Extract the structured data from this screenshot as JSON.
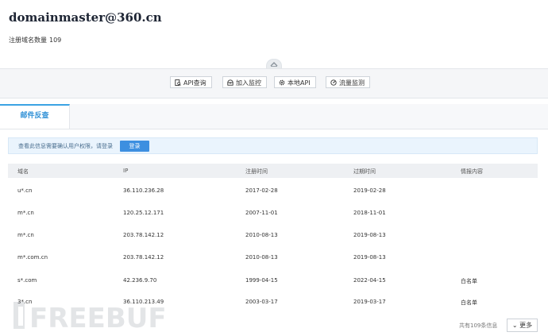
{
  "header": {
    "email": "domainmaster@360.cn",
    "count_label": "注册域名数量",
    "count_value": "109"
  },
  "toolbar": {
    "api_query": "API查询",
    "add_monitor": "加入监控",
    "local_api": "本地API",
    "traffic_monitor": "流量监测"
  },
  "tabs": [
    {
      "label": "邮件反查",
      "active": true
    }
  ],
  "notice": {
    "message": "查看此信息需要确认用户权限，请登录",
    "login_label": "登录"
  },
  "table": {
    "columns": [
      "域名",
      "IP",
      "注册时间",
      "过期时间",
      "情报内容"
    ],
    "rows": [
      {
        "domain": "u*.cn",
        "ip": "36.110.236.28",
        "registered": "2017-02-28",
        "expires": "2019-02-28",
        "intel": ""
      },
      {
        "domain": "m*.cn",
        "ip": "120.25.12.171",
        "registered": "2007-11-01",
        "expires": "2018-11-01",
        "intel": ""
      },
      {
        "domain": "m*.cn",
        "ip": "203.78.142.12",
        "registered": "2010-08-13",
        "expires": "2019-08-13",
        "intel": ""
      },
      {
        "domain": "m*.com.cn",
        "ip": "203.78.142.12",
        "registered": "2010-08-13",
        "expires": "2019-08-13",
        "intel": ""
      },
      {
        "domain": "s*.com",
        "ip": "42.236.9.70",
        "registered": "1999-04-15",
        "expires": "2022-04-15",
        "intel": "白名单"
      },
      {
        "domain": "3*.cn",
        "ip": "36.110.213.49",
        "registered": "2003-03-17",
        "expires": "2019-03-17",
        "intel": "白名单"
      }
    ]
  },
  "footer": {
    "total_info": "共有109条信息",
    "more_label": "更多"
  },
  "watermark": {
    "text": "FREEBUF"
  },
  "colors": {
    "accent": "#3ba3e3",
    "login_button": "#3d8fe0",
    "notice_bg": "#eaf4fd"
  }
}
